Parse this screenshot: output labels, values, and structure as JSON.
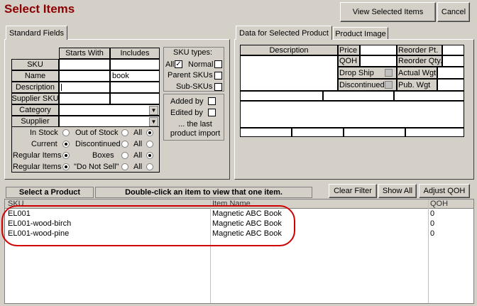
{
  "window_title": "Select Items",
  "buttons": {
    "view_selected": "View Selected Items",
    "cancel": "Cancel",
    "clear_filter": "Clear Filter",
    "show_all": "Show All",
    "adjust_qoh": "Adjust QOH"
  },
  "tabs": {
    "standard_fields": "Standard Fields",
    "data_for_selected": "Data for Selected Product",
    "product_image": "Product Image"
  },
  "filter": {
    "col_starts_with": "Starts With",
    "col_includes": "Includes",
    "sku_label": "SKU",
    "name_label": "Name",
    "name_includes_value": "book",
    "description_label": "Description",
    "supplier_sku_label": "Supplier SKU",
    "category_label": "Category",
    "supplier_label": "Supplier",
    "in_stock_label": "In Stock",
    "out_of_stock_label": "Out of Stock",
    "all_label": "All",
    "current_label": "Current",
    "discontinued_label": "Discontinued",
    "regular_items_label": "Regular Items",
    "boxes_label": "Boxes",
    "do_not_sell_label": "\"Do Not Sell\""
  },
  "sku_types": {
    "header": "SKU types:",
    "all": "All",
    "normal": "Normal",
    "parent_skus": "Parent SKUs",
    "sub_skus": "Sub-SKUs"
  },
  "added_edited": {
    "added_by": "Added by",
    "edited_by": "Edited by",
    "last_import": "... the last product import"
  },
  "product_data": {
    "description": "Description",
    "price": "Price",
    "qoh": "QOH",
    "drop_ship": "Drop Ship",
    "discontinued": "Discontinued",
    "reorder_pt": "Reorder Pt.",
    "reorder_qty": "Reorder Qty.",
    "actual_wgt": "Actual Wgt",
    "pub_wgt": "Pub. Wgt"
  },
  "list": {
    "select_product": "Select a Product",
    "hint": "Double-click an item to view that one item.",
    "columns": {
      "sku": "SKU",
      "item_name": "Item Name",
      "qoh": "QOH"
    },
    "rows": [
      {
        "sku": "EL001",
        "item_name": "Magnetic ABC Book",
        "qoh": "0"
      },
      {
        "sku": "EL001-wood-birch",
        "item_name": "Magnetic ABC Book",
        "qoh": "0"
      },
      {
        "sku": "EL001-wood-pine",
        "item_name": "Magnetic ABC Book",
        "qoh": "0"
      }
    ]
  },
  "colors": {
    "title": "#8b0000",
    "highlight_ellipse": "#d00000",
    "window_bg": "#d4d0c8"
  }
}
